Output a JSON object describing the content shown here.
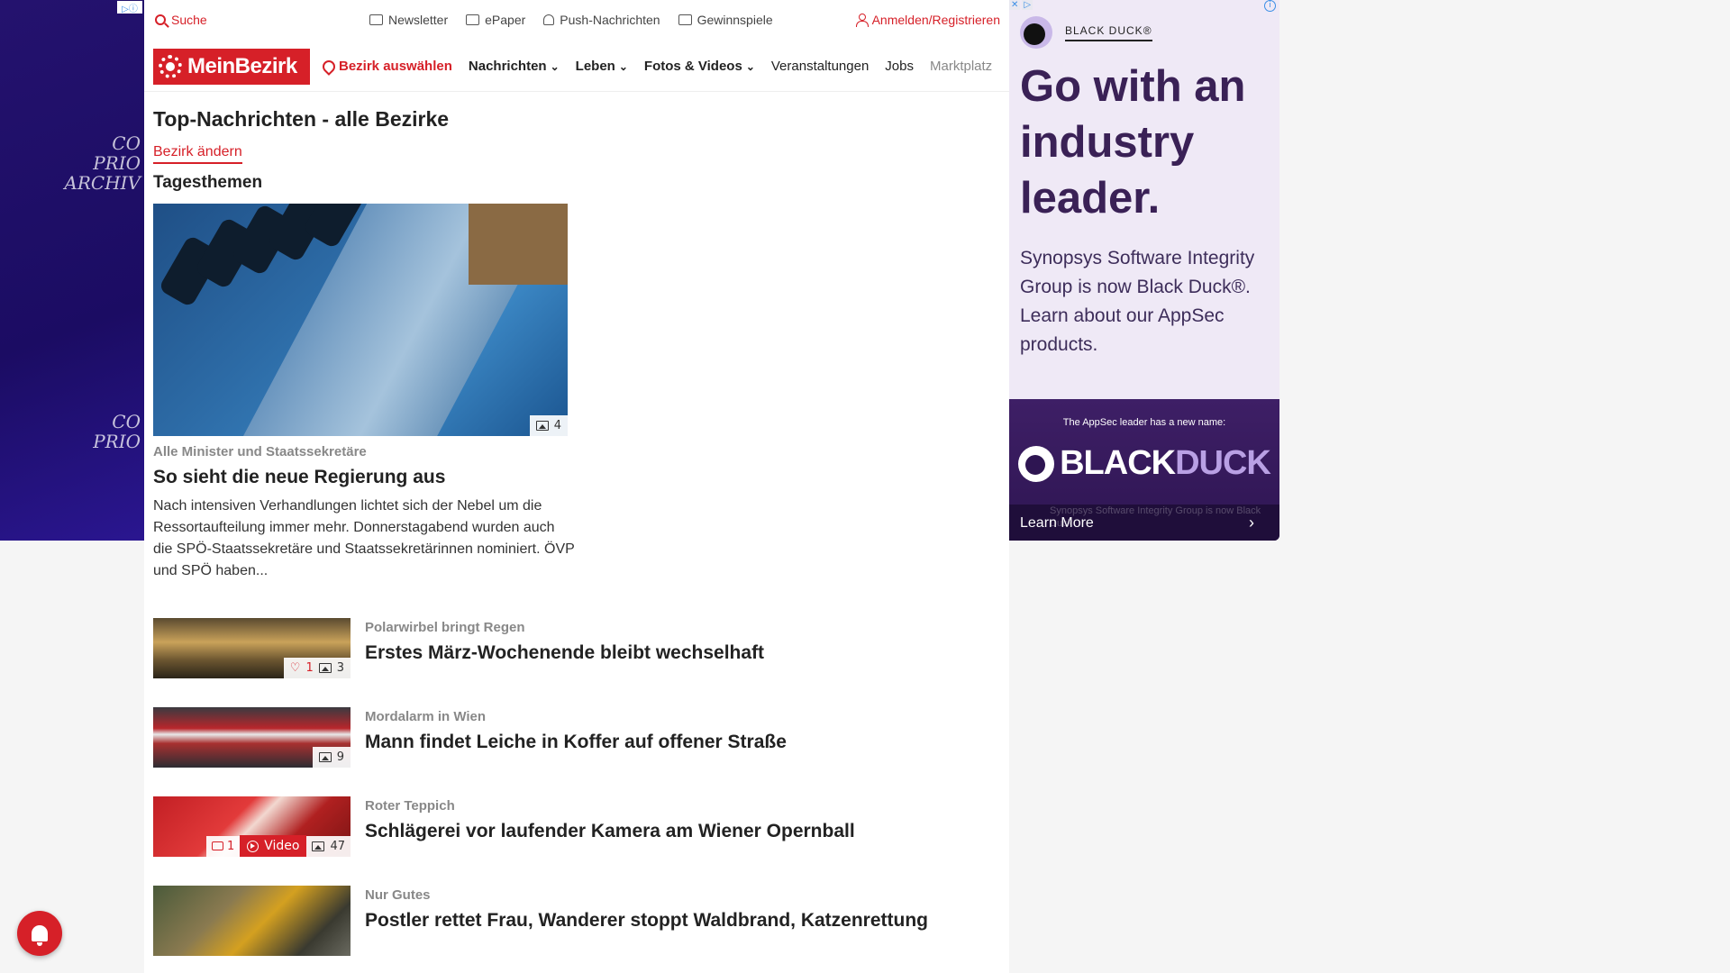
{
  "topbar": {
    "search": "Suche",
    "newsletter": "Newsletter",
    "epaper": "ePaper",
    "push": "Push-Nachrichten",
    "gewinnspiele": "Gewinnspiele",
    "login": "Anmelden/Registrieren"
  },
  "nav": {
    "logo": "MeinBezirk",
    "pick": "Bezirk auswählen",
    "items": [
      "Nachrichten",
      "Leben",
      "Fotos & Videos",
      "Veranstaltungen",
      "Jobs",
      "Marktplatz"
    ]
  },
  "page": {
    "title": "Top-Nachrichten - alle Bezirke",
    "change": "Bezirk ändern",
    "section": "Tagesthemen"
  },
  "hero": {
    "image_count": "4",
    "kicker": "Alle Minister und Staatssekretäre",
    "title": "So sieht die neue Regierung aus",
    "teaser": "Nach intensiven Verhandlungen lichtet sich der Nebel um die Ressortaufteilung immer mehr. Donnerstagabend wurden auch die SPÖ-Staatssekretäre und Staatssekretärinnen nominiert. ÖVP und SPÖ haben..."
  },
  "articles": [
    {
      "kicker": "Polarwirbel bringt Regen",
      "title": "Erstes März-Wochenende bleibt wechselhaft",
      "likes": "1",
      "images": "3"
    },
    {
      "kicker": "Mordalarm in Wien",
      "title": "Mann findet Leiche in Koffer auf offener Straße",
      "images": "9"
    },
    {
      "kicker": "Roter Teppich",
      "title": "Schlägerei vor laufender Kamera am Wiener Opernball",
      "comments": "1",
      "video": "Video",
      "images": "47"
    },
    {
      "kicker": "Nur Gutes",
      "title": "Postler rettet Frau, Wanderer stoppt Waldbrand, Katzenrettung"
    }
  ],
  "right_ad": {
    "brand": "BLACK DUCK®",
    "headline": "Go with an industry leader.",
    "sub": "Synopsys Software Integrity Group is now Black Duck®. Learn about our AppSec products.",
    "tagline": "The AppSec leader has a new name:",
    "logo_a": "BLACK",
    "logo_b": "DUCK",
    "faint": "Synopsys Software Integrity Group is now Black Duck",
    "cta": "Learn More"
  },
  "left_ad": {
    "ghost": [
      "CO",
      "PRIO",
      "ARCHIV"
    ]
  },
  "colors": {
    "accent": "#d62028",
    "ad_purple": "#3a2156"
  }
}
